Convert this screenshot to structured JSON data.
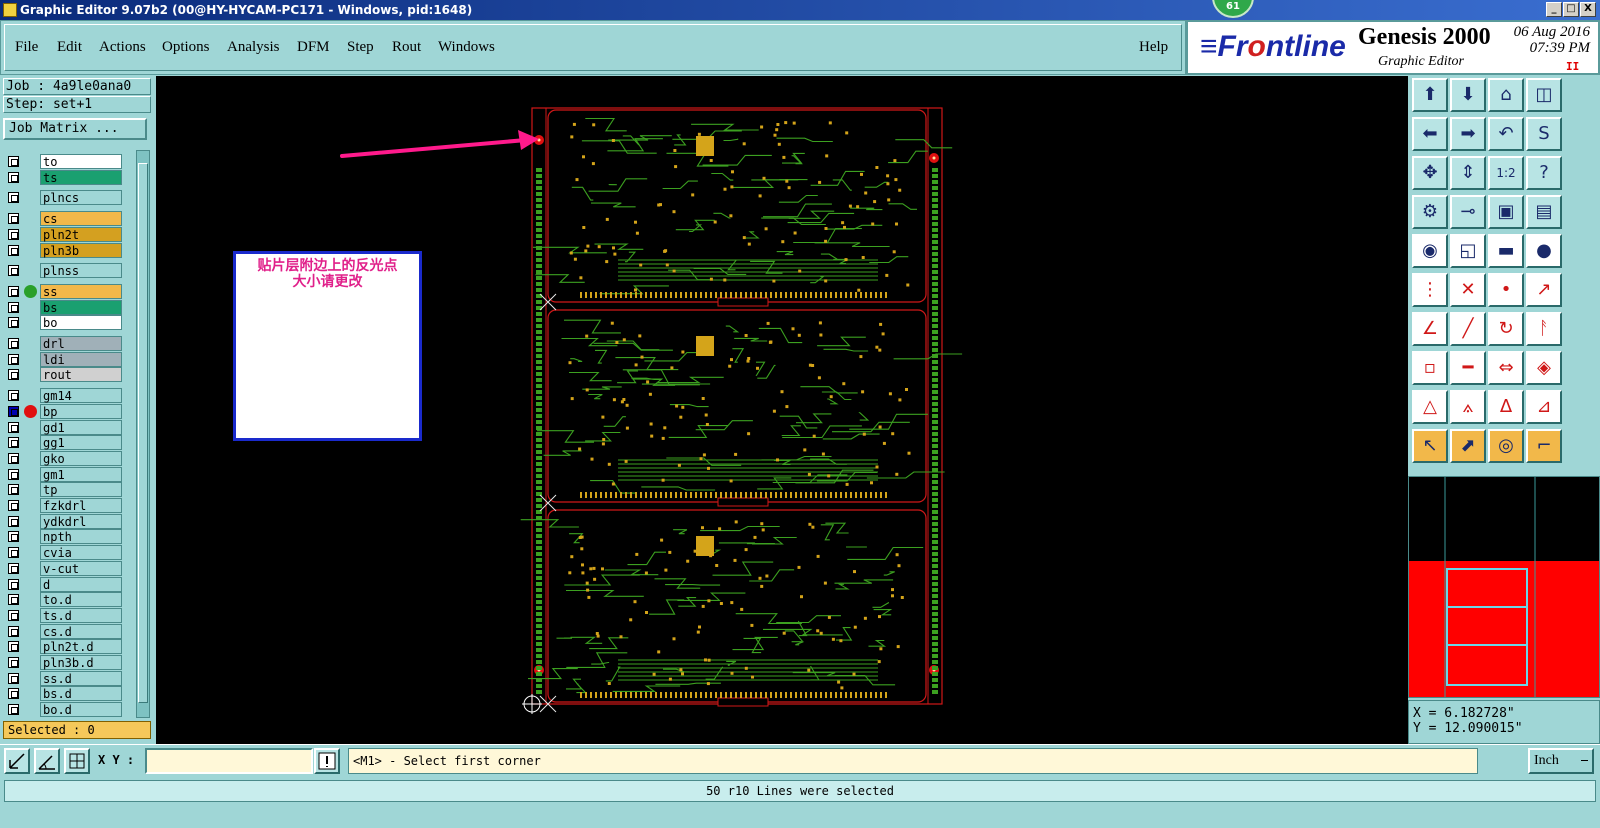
{
  "window": {
    "title": "Graphic Editor 9.07b2 (00@HY-HYCAM-PC171 - Windows, pid:1648)",
    "badge": "61",
    "controls": [
      "_",
      "□",
      "X"
    ]
  },
  "menu": {
    "items": [
      "File",
      "Edit",
      "Actions",
      "Options",
      "Analysis",
      "DFM",
      "Step",
      "Rout",
      "Windows"
    ],
    "help": "Help"
  },
  "branding": {
    "logo_pre": "≡Fr",
    "logo_o": "o",
    "logo_post": "ntline",
    "product": "Genesis 2000",
    "subtitle": "Graphic Editor",
    "date": "06 Aug 2016",
    "time": "07:39 PM",
    "pause_mark": "II"
  },
  "job": {
    "job_label": "Job : 4a9le0ana0",
    "step_label": "Step: set+1",
    "matrix_button": "Job Matrix ..."
  },
  "layers": [
    {
      "name": "to",
      "color": "#ffffff",
      "dot": ""
    },
    {
      "name": "ts",
      "color": "#1aa070",
      "dot": ""
    },
    {
      "name": "plncs",
      "color": "#9fd6d6",
      "dot": ""
    },
    {
      "name": "cs",
      "color": "#f2b84a",
      "dot": ""
    },
    {
      "name": "pln2t",
      "color": "#d4a020",
      "dot": ""
    },
    {
      "name": "pln3b",
      "color": "#d4a020",
      "dot": ""
    },
    {
      "name": "plnss",
      "color": "#9fd6d6",
      "dot": ""
    },
    {
      "name": "ss",
      "color": "#f2b84a",
      "dot": "#2aa02a"
    },
    {
      "name": "bs",
      "color": "#1aa070",
      "dot": ""
    },
    {
      "name": "bo",
      "color": "#ffffff",
      "dot": ""
    },
    {
      "name": "drl",
      "color": "#a0b0b8",
      "dot": ""
    },
    {
      "name": "ldi",
      "color": "#a0b0b8",
      "dot": ""
    },
    {
      "name": "rout",
      "color": "#d0d0d0",
      "dot": ""
    },
    {
      "name": "gm14",
      "color": "#9fd6d6",
      "dot": ""
    },
    {
      "name": "bp",
      "color": "#9fd6d6",
      "dot": "#e01010",
      "active": true
    },
    {
      "name": "gd1",
      "color": "#9fd6d6",
      "dot": ""
    },
    {
      "name": "gg1",
      "color": "#9fd6d6",
      "dot": ""
    },
    {
      "name": "gko",
      "color": "#9fd6d6",
      "dot": ""
    },
    {
      "name": "gm1",
      "color": "#9fd6d6",
      "dot": ""
    },
    {
      "name": "tp",
      "color": "#9fd6d6",
      "dot": ""
    },
    {
      "name": "fzkdrl",
      "color": "#9fd6d6",
      "dot": ""
    },
    {
      "name": "ydkdrl",
      "color": "#9fd6d6",
      "dot": ""
    },
    {
      "name": "npth",
      "color": "#9fd6d6",
      "dot": ""
    },
    {
      "name": "cvia",
      "color": "#9fd6d6",
      "dot": ""
    },
    {
      "name": "v-cut",
      "color": "#9fd6d6",
      "dot": ""
    },
    {
      "name": "d",
      "color": "#9fd6d6",
      "dot": ""
    },
    {
      "name": "to.d",
      "color": "#9fd6d6",
      "dot": ""
    },
    {
      "name": "ts.d",
      "color": "#9fd6d6",
      "dot": ""
    },
    {
      "name": "cs.d",
      "color": "#9fd6d6",
      "dot": ""
    },
    {
      "name": "pln2t.d",
      "color": "#9fd6d6",
      "dot": ""
    },
    {
      "name": "pln3b.d",
      "color": "#9fd6d6",
      "dot": ""
    },
    {
      "name": "ss.d",
      "color": "#9fd6d6",
      "dot": ""
    },
    {
      "name": "bs.d",
      "color": "#9fd6d6",
      "dot": ""
    },
    {
      "name": "bo.d",
      "color": "#9fd6d6",
      "dot": ""
    }
  ],
  "selected_count": "Selected : 0",
  "annotation": {
    "line1": "贴片层附边上的反光点",
    "line2": "大小请更改",
    "arrow_color": "#ff1a8c"
  },
  "pcb": {
    "outline_color": "#d01818",
    "trace_color": "#3ca020",
    "pad_color": "#d4a41a"
  },
  "coordinates": {
    "x": "X = 6.182728\"",
    "y": "Y = 12.090015\""
  },
  "command": {
    "xy_label": "X Y :",
    "xy_value": "",
    "prompt": "<M1> - Select first corner",
    "unit": "Inch"
  },
  "status_message": "50 r10 Lines were selected"
}
